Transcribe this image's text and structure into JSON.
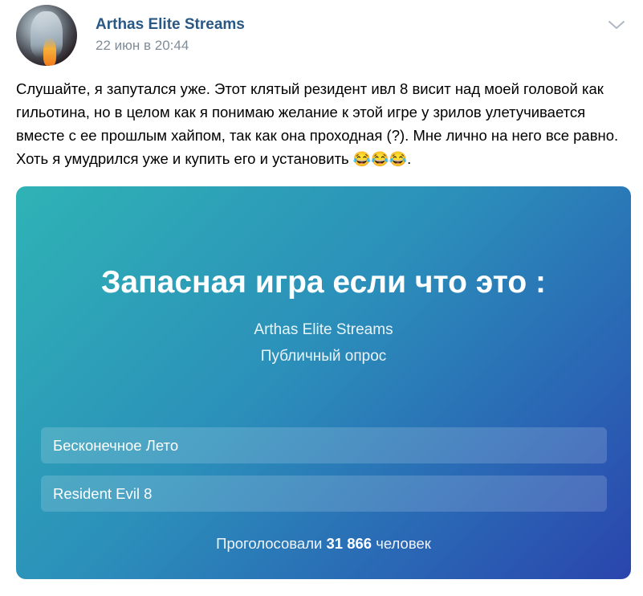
{
  "post": {
    "author": "Arthas Elite Streams",
    "date": "22 июн в 20:44",
    "text": "Слушайте, я запутался уже. Этот клятый резидент ивл 8 висит над моей головой как гильотина, но в целом как я понимаю желание к этой игре у зрилов улетучивается вместе с ее прошлым хайпом, так как она проходная (?). Мне лично на него все равно. Хоть я умудрился уже и купить его и установить",
    "emoji": "😂😂😂",
    "text_end": "."
  },
  "poll": {
    "title": "Запасная игра если что это :",
    "owner": "Arthas Elite Streams",
    "type": "Публичный опрос",
    "options": [
      {
        "label": "Бесконечное Лето"
      },
      {
        "label": "Resident Evil 8"
      }
    ],
    "footer_prefix": "Проголосовали",
    "votes": "31 866",
    "footer_suffix": "человек"
  },
  "colors": {
    "author": "#2a5885",
    "date": "#818c99",
    "poll_gradient_start": "#2fb3b5",
    "poll_gradient_end": "#2a45ad"
  },
  "icons": {
    "menu": "chevron-down-icon",
    "avatar": "avatar-image"
  }
}
